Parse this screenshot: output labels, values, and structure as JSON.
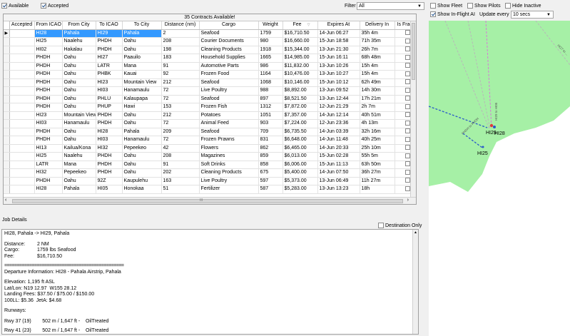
{
  "top_filters": {
    "available_label": "Available",
    "accepted_label": "Accepted",
    "filter_label": "Filter",
    "filter_value": "All"
  },
  "map_options": {
    "show_fleet": "Show Fleet",
    "show_pilots": "Show Pilots",
    "hide_inactive": "Hide Inactive",
    "show_inflight_ai": "Show In-Flight AI",
    "update_every_label": "Update every",
    "update_every_value": "10 secs"
  },
  "grid": {
    "title": "35 Contracts Available!",
    "columns": [
      "Accepted",
      "From ICAO",
      "From City",
      "To ICAO",
      "To City",
      "Distance (nm)",
      "Cargo",
      "Weight",
      "Fee",
      "Expires At",
      "Delivery In",
      "Is Fragile"
    ],
    "rows": [
      [
        "",
        "HI28",
        "Pahala",
        "HI29",
        "Pahala",
        "2",
        "Seafood",
        "1759",
        "$16,710.50",
        "14-Jun 06:27",
        "35h 4m"
      ],
      [
        "",
        "HI25",
        "Naalehu",
        "PHDH",
        "Oahu",
        "208",
        "Courier Documents",
        "980",
        "$16,660.00",
        "15-Jun 18:58",
        "71h 35m"
      ],
      [
        "",
        "HI02",
        "Hakalau",
        "PHDH",
        "Oahu",
        "198",
        "Cleaning Products",
        "1918",
        "$15,344.00",
        "13-Jun 21:30",
        "26h 7m"
      ],
      [
        "",
        "PHDH",
        "Oahu",
        "HI27",
        "Paauilo",
        "183",
        "Household Supplies",
        "1665",
        "$14,985.00",
        "15-Jun 16:11",
        "68h 48m"
      ],
      [
        "",
        "PHDH",
        "Oahu",
        "LATR",
        "Mana",
        "91",
        "Automotive Parts",
        "986",
        "$11,832.00",
        "13-Jun 10:26",
        "15h 4m"
      ],
      [
        "",
        "PHDH",
        "Oahu",
        "PHBK",
        "Kauai",
        "92",
        "Frozen Food",
        "1164",
        "$10,476.00",
        "13-Jun 10:27",
        "15h 4m"
      ],
      [
        "",
        "PHDH",
        "Oahu",
        "HI23",
        "Mountain View",
        "212",
        "Seafood",
        "1068",
        "$10,146.00",
        "15-Jun 10:12",
        "62h 49m"
      ],
      [
        "",
        "PHDH",
        "Oahu",
        "HI03",
        "Hanamaulu",
        "72",
        "Live Poultry",
        "988",
        "$8,892.00",
        "13-Jun 09:52",
        "14h 30m"
      ],
      [
        "",
        "PHDH",
        "Oahu",
        "PHLU",
        "Kalaupapa",
        "72",
        "Seafood",
        "897",
        "$8,521.50",
        "13-Jun 12:44",
        "17h 21m"
      ],
      [
        "",
        "PHDH",
        "Oahu",
        "PHUP",
        "Hawi",
        "153",
        "Frozen Fish",
        "1312",
        "$7,872.00",
        "12-Jun 21:29",
        "2h 7m"
      ],
      [
        "",
        "HI23",
        "Mountain View",
        "PHDH",
        "Oahu",
        "212",
        "Potatoes",
        "1051",
        "$7,357.00",
        "14-Jun 12:14",
        "40h 51m"
      ],
      [
        "",
        "HI03",
        "Hanamaulu",
        "PHDH",
        "Oahu",
        "72",
        "Animal Feed",
        "903",
        "$7,224.00",
        "12-Jun 23:36",
        "4h 13m"
      ],
      [
        "",
        "PHDH",
        "Oahu",
        "HI28",
        "Pahala",
        "209",
        "Seafood",
        "709",
        "$6,735.50",
        "14-Jun 03:39",
        "32h 16m"
      ],
      [
        "",
        "PHDH",
        "Oahu",
        "HI03",
        "Hanamaulu",
        "72",
        "Frozen Prawns",
        "831",
        "$6,648.00",
        "14-Jun 11:48",
        "40h 25m"
      ],
      [
        "",
        "HI13",
        "Kailua/Kona",
        "HI32",
        "Pepeekeo",
        "42",
        "Flowers",
        "862",
        "$6,465.00",
        "14-Jun 20:33",
        "25h 10m"
      ],
      [
        "",
        "HI25",
        "Naalehu",
        "PHDH",
        "Oahu",
        "208",
        "Magazines",
        "859",
        "$6,013.00",
        "15-Jun 02:28",
        "55h 5m"
      ],
      [
        "",
        "LATR",
        "Mana",
        "PHDH",
        "Oahu",
        "91",
        "Soft Drinks",
        "858",
        "$6,006.00",
        "15-Jun 11:13",
        "63h 50m"
      ],
      [
        "",
        "HI32",
        "Pepeekeo",
        "PHDH",
        "Oahu",
        "202",
        "Cleaning Products",
        "675",
        "$5,400.00",
        "14-Jun 07:50",
        "36h 27m"
      ],
      [
        "",
        "PHDH",
        "Oahu",
        "92Z",
        "Kaupulehu",
        "163",
        "Live Poultry",
        "597",
        "$5,373.00",
        "13-Jun 06:49",
        "11h 27m"
      ],
      [
        "",
        "HI28",
        "Pahala",
        "HI05",
        "Honokaa",
        "51",
        "Fertilizer",
        "587",
        "$5,283.00",
        "13-Jun 13:23",
        "18h"
      ]
    ],
    "scroll_marker": "III"
  },
  "job_details": {
    "section_label": "Job Details",
    "destination_only_label": "Destination Only",
    "route_line": "HI28, Pahala -> HI29, Pahala",
    "distance_key": "Distance:",
    "distance_val": "2 NM",
    "cargo_key": "Cargo:",
    "cargo_val": "1759 lbs Seafood",
    "fee_key": "Fee:",
    "fee_val": "$16,710.50",
    "separator": "================================================",
    "departure_info": "Departure Information: HI28 - Pahala Airstrip, Pahala",
    "elevation": "Elevation: 1,195 ft ASL",
    "latlon": "Lat/Lon: N19 12.97  W155 28.12",
    "landing_fees": "Landing Fees: $37.50 / $75.00 / $150.00",
    "fuel": "100LL: $5.36  JetA: $4.68",
    "runways_label": "Runways:",
    "runway_1": "Rwy 37 (19)        502 m / 1,647 ft -    OilTreated",
    "runway_2": "Rwy 41 (23)        502 m / 1,647 ft -    OilTreated"
  },
  "map": {
    "labels": {
      "hi29": "HI29",
      "hi28": "HI28",
      "hi25": "HI25",
      "route_a": "HI29 to HI05",
      "route_b": "PHDH to PHDH",
      "route_c": "HI27 to ..."
    },
    "colors": {
      "land": "#a6f0a6",
      "route_gray": "#b8b8b8",
      "route_blue": "#2a59c9",
      "route_red": "#e23a3a",
      "route_pink": "#d77ad7"
    }
  }
}
